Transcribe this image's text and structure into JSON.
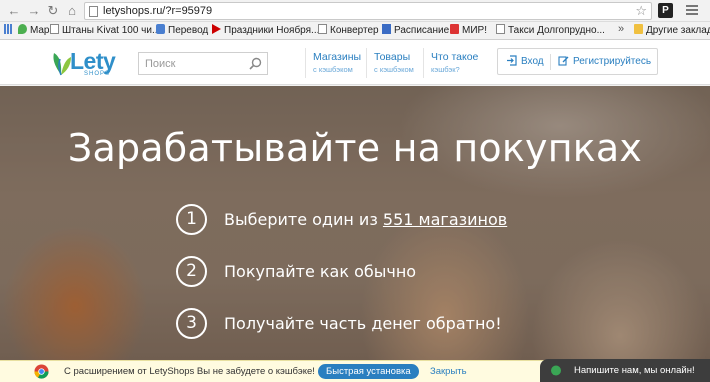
{
  "browser": {
    "url": "letyshops.ru/?r=95979",
    "bookmarks": [
      {
        "label": "Maps",
        "icon": "maps-icon"
      },
      {
        "label": "Штаны Kivat 100 чи...",
        "icon": "page-icon"
      },
      {
        "label": "Перевод",
        "icon": "translate-icon"
      },
      {
        "label": "Праздники Ноября...",
        "icon": "play-icon"
      },
      {
        "label": "Конвертер",
        "icon": "page-icon"
      },
      {
        "label": "Расписание",
        "icon": "calendar-icon"
      },
      {
        "label": "МИР!",
        "icon": "mir-icon"
      },
      {
        "label": "Такси Долгопрудно...",
        "icon": "page-icon"
      },
      {
        "label": "Другие закладки",
        "icon": "folder-icon"
      }
    ],
    "more_label": "»"
  },
  "header": {
    "logo_word": "Lety",
    "logo_sub": "SHOPS",
    "search_placeholder": "Поиск",
    "nav": [
      {
        "main": "Магазины",
        "sub": "с кэшбэком"
      },
      {
        "main": "Товары",
        "sub": "с кэшбэком"
      },
      {
        "main": "Что такое",
        "sub": "кэшбэк?"
      }
    ],
    "login_label": "Вход",
    "register_label": "Регистрируйтесь"
  },
  "hero": {
    "title": "Зарабатывайте на покупках",
    "steps": [
      {
        "num": "1",
        "text": "Выберите один из ",
        "link": "551 магазинов"
      },
      {
        "num": "2",
        "text": "Покупайте как обычно"
      },
      {
        "num": "3",
        "text": "Получайте часть денег обратно!"
      }
    ]
  },
  "extension_bar": {
    "text": "С расширением от LetyShops Вы не забудете о кэшбэке!",
    "install_label": "Быстрая установка",
    "close_label": "Закрыть",
    "chat_label": "Напишите нам, мы онлайн!"
  },
  "colors": {
    "brand_blue": "#2a7fc0",
    "banner_bg": "#fffbe0",
    "chat_bg": "#3d3d3d"
  }
}
